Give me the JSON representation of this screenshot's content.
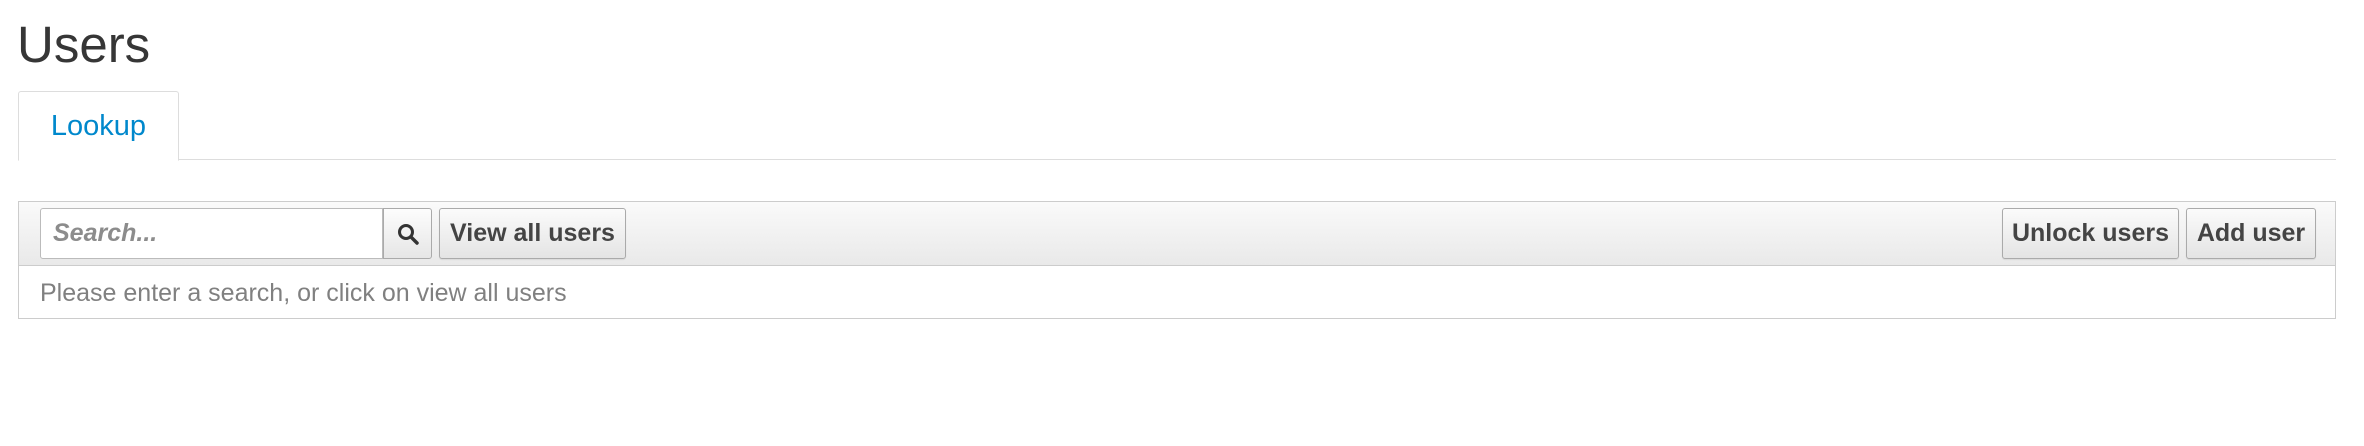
{
  "page": {
    "title": "Users"
  },
  "tabs": [
    {
      "label": "Lookup",
      "active": true
    }
  ],
  "toolbar": {
    "search_placeholder": "Search...",
    "search_value": "",
    "search_icon": "search-icon",
    "view_all_label": "View all users",
    "unlock_label": "Unlock users",
    "add_label": "Add user"
  },
  "results": {
    "empty_message": "Please enter a search, or click on view all users"
  },
  "colors": {
    "accent": "#0088cc",
    "border": "#cccccc",
    "muted_text": "#808080"
  }
}
